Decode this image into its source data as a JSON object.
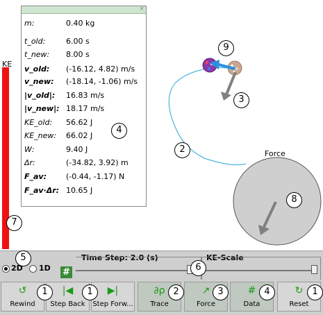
{
  "ke_bar": {
    "label": "KE"
  },
  "data_panel": {
    "close": "×",
    "rows": [
      {
        "name": "m:",
        "value": "0.40 kg"
      },
      {
        "name": "t_old:",
        "value": "6.00 s"
      },
      {
        "name": "t_new:",
        "value": "8.00 s"
      },
      {
        "name": "v_old:",
        "value": "(-16.12, 4.82) m/s"
      },
      {
        "name": "v_new:",
        "value": "(-18.14, -1.06) m/s"
      },
      {
        "name": "|v_old|:",
        "value": "16.83 m/s"
      },
      {
        "name": "|v_new|:",
        "value": "18.17 m/s"
      },
      {
        "name": "KE_old:",
        "value": "56.62 J"
      },
      {
        "name": "KE_new:",
        "value": "66.02 J"
      },
      {
        "name": "W:",
        "value": "9.40 J"
      },
      {
        "name": "Δr:",
        "value": "(-34.82, 3.92) m"
      },
      {
        "name": "F_av:",
        "value": "(-0.44, -1.17) N"
      },
      {
        "name": "F_av·Δr:",
        "value": "10.65 J"
      }
    ]
  },
  "force_dial": {
    "label": "Force"
  },
  "markers": [
    "1",
    "2",
    "3",
    "4",
    "5",
    "6",
    "7",
    "8",
    "9"
  ],
  "dimension": {
    "option_2d": "2D",
    "option_1d": "1D",
    "selected": "2D"
  },
  "time_step": {
    "label": "Time Step: 2.0 (s)",
    "hash": "#"
  },
  "ke_scale": {
    "label": "KE-Scale"
  },
  "buttons": {
    "rewind": "Rewind",
    "step_back": "Step Back",
    "step_forward": "Step Forw...",
    "trace": "Trace",
    "force": "Force",
    "data": "Data",
    "reset": "Reset"
  },
  "colors": {
    "ke_bar": "#ee1111",
    "trajectory": "#2aa7d6",
    "velocity_arrow": "#2a8fe0",
    "force_arrow": "#808080",
    "button_icon": "#1a9a1a"
  }
}
